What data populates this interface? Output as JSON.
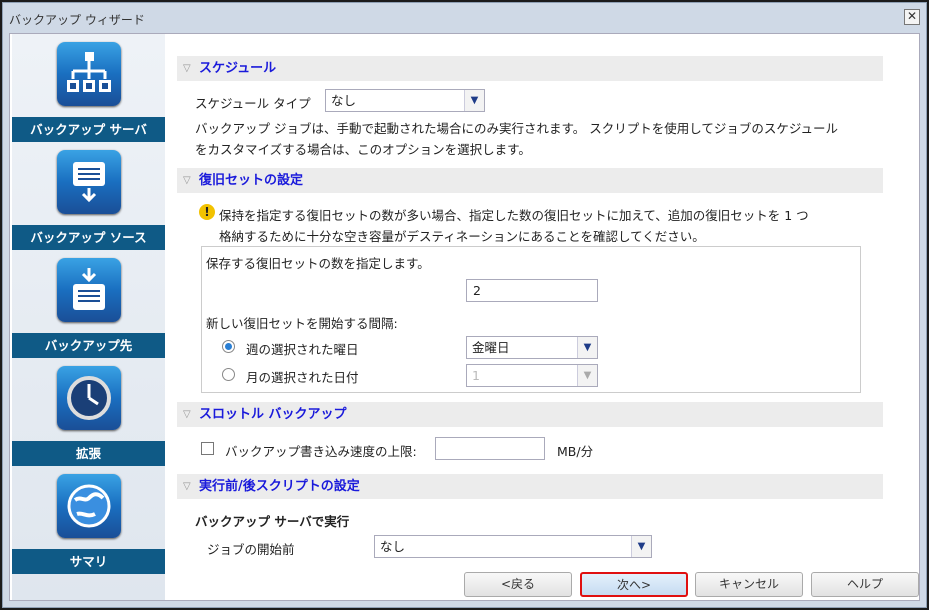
{
  "window": {
    "title": "バックアップ ウィザード",
    "close": "✕"
  },
  "sidebar": {
    "items": [
      {
        "label": "バックアップ サーバ",
        "icon": "server-tree-icon"
      },
      {
        "label": "バックアップ ソース",
        "icon": "drive-source-icon"
      },
      {
        "label": "バックアップ先",
        "icon": "drive-destination-icon"
      },
      {
        "label": "拡張",
        "icon": "clock-icon"
      },
      {
        "label": "サマリ",
        "icon": "globe-icon"
      }
    ]
  },
  "schedule": {
    "header": "スケジュール",
    "type_label": "スケジュール タイプ",
    "type_value": "なし",
    "desc1": "バックアップ ジョブは、手動で起動された場合にのみ実行されます。 スクリプトを使用してジョブのスケジュール",
    "desc2": "をカスタマイズする場合は、このオプションを選択します。"
  },
  "recovery": {
    "header": "復旧セットの設定",
    "warn1": "保持を指定する復旧セットの数が多い場合、指定した数の復旧セットに加えて、追加の復旧セットを 1 つ",
    "warn2": "格納するために十分な空き容量がデスティネーションにあることを確認してください。",
    "count_label": "保存する復旧セットの数を指定します。",
    "count_value": "2",
    "interval_label": "新しい復旧セットを開始する間隔:",
    "weekday_label": "週の選択された曜日",
    "weekday_value": "金曜日",
    "monthday_label": "月の選択された日付",
    "monthday_value": "1"
  },
  "throttle": {
    "header": "スロットル バックアップ",
    "label": "バックアップ書き込み速度の上限:",
    "value": "",
    "unit": "MB/分"
  },
  "scripts": {
    "header": "実行前/後スクリプトの設定",
    "sub": "バックアップ サーバで実行",
    "before_label": "ジョブの開始前",
    "before_value": "なし"
  },
  "buttons": {
    "back": "<戻る",
    "next": "次へ>",
    "cancel": "キャンセル",
    "help": "ヘルプ"
  }
}
